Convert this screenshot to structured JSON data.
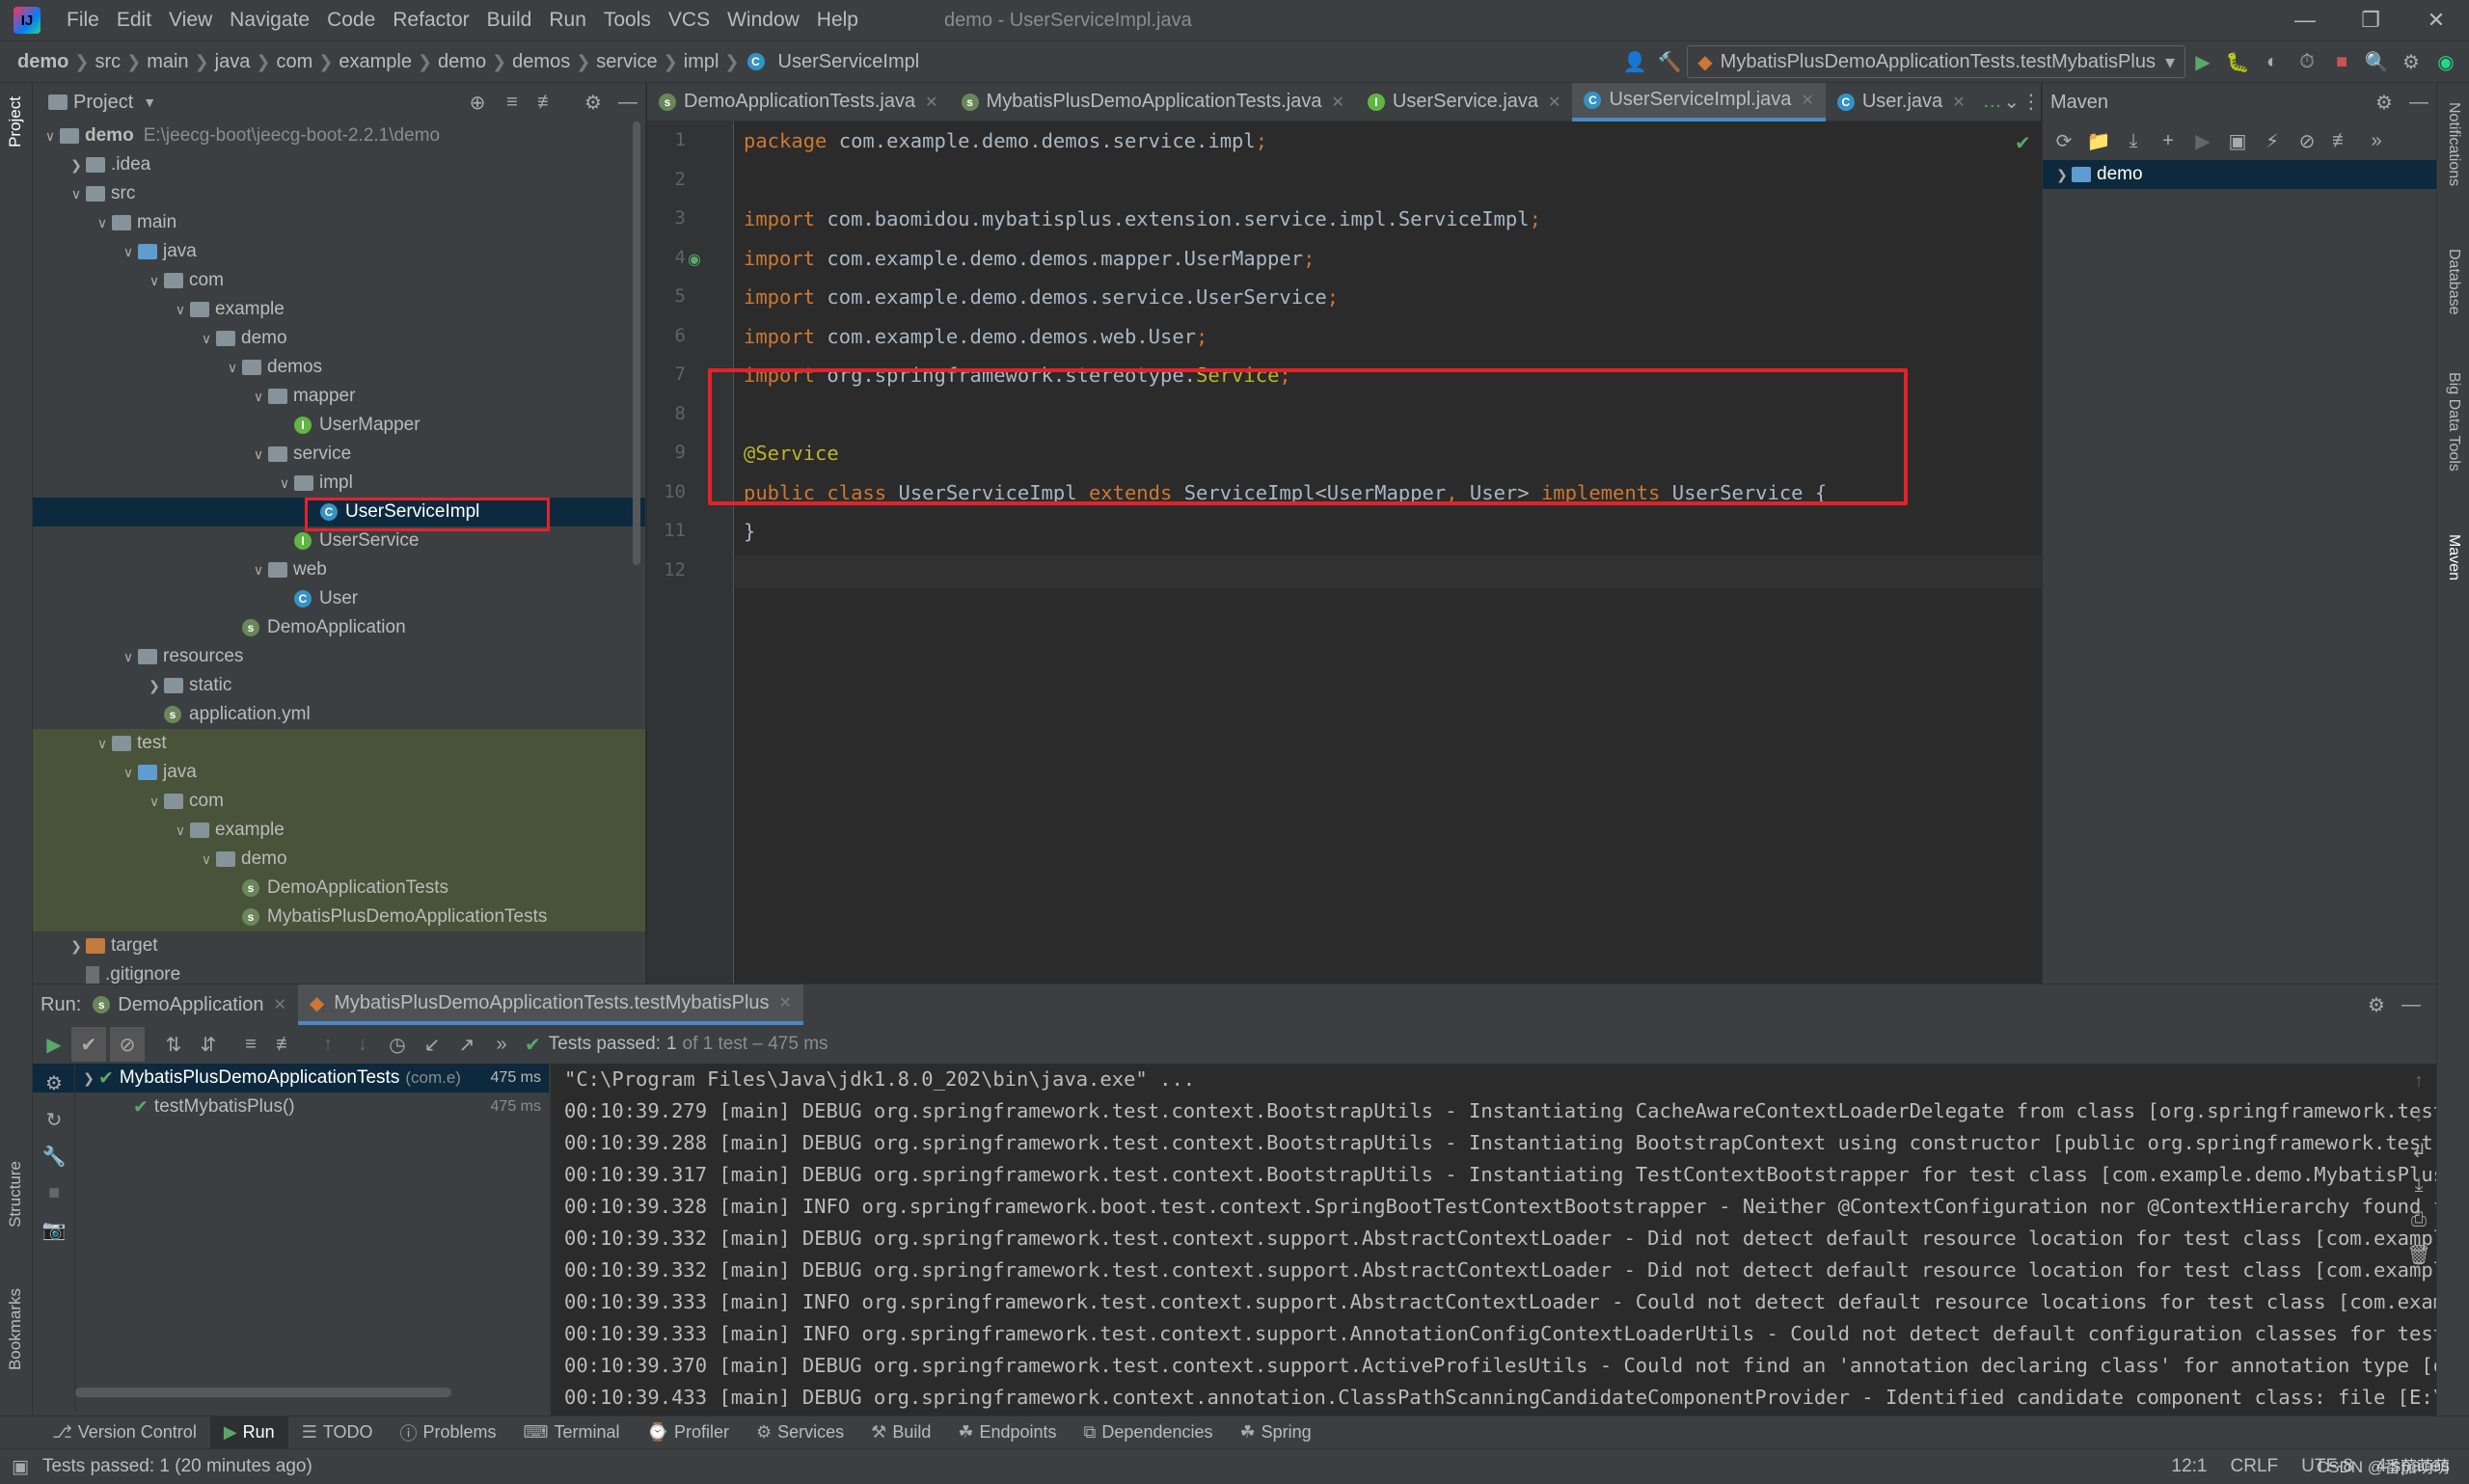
{
  "window": {
    "title": "demo - UserServiceImpl.java",
    "menu": [
      "File",
      "Edit",
      "View",
      "Navigate",
      "Code",
      "Refactor",
      "Build",
      "Run",
      "Tools",
      "VCS",
      "Window",
      "Help"
    ]
  },
  "breadcrumb": [
    "demo",
    "src",
    "main",
    "java",
    "com",
    "example",
    "demo",
    "demos",
    "service",
    "impl",
    "UserServiceImpl"
  ],
  "run_config": "MybatisPlusDemoApplicationTests.testMybatisPlus",
  "left_stripe": {
    "project": "Project",
    "structure": "Structure",
    "bookmarks": "Bookmarks"
  },
  "right_stripe": {
    "notifications": "Notifications",
    "database": "Database",
    "big_data": "Big Data Tools",
    "maven": "Maven"
  },
  "project_panel": {
    "title": "Project",
    "root_path": "E:\\jeecg-boot\\jeecg-boot-2.2.1\\demo",
    "tree": [
      {
        "label": "demo",
        "level": 0,
        "icon": "folder",
        "arrow": "down",
        "bold": true
      },
      {
        "label": ".idea",
        "level": 1,
        "icon": "folder",
        "arrow": "right"
      },
      {
        "label": "src",
        "level": 1,
        "icon": "folder",
        "arrow": "down"
      },
      {
        "label": "main",
        "level": 2,
        "icon": "folder",
        "arrow": "down"
      },
      {
        "label": "java",
        "level": 3,
        "icon": "folder-blue",
        "arrow": "down"
      },
      {
        "label": "com",
        "level": 4,
        "icon": "folder",
        "arrow": "down"
      },
      {
        "label": "example",
        "level": 5,
        "icon": "folder",
        "arrow": "down"
      },
      {
        "label": "demo",
        "level": 6,
        "icon": "folder",
        "arrow": "down"
      },
      {
        "label": "demos",
        "level": 7,
        "icon": "folder",
        "arrow": "down"
      },
      {
        "label": "mapper",
        "level": 8,
        "icon": "folder",
        "arrow": "down"
      },
      {
        "label": "UserMapper",
        "level": 9,
        "icon": "interface"
      },
      {
        "label": "service",
        "level": 8,
        "icon": "folder",
        "arrow": "down"
      },
      {
        "label": "impl",
        "level": 9,
        "icon": "folder",
        "arrow": "down"
      },
      {
        "label": "UserServiceImpl",
        "level": 10,
        "icon": "class",
        "selected": true
      },
      {
        "label": "UserService",
        "level": 9,
        "icon": "interface"
      },
      {
        "label": "web",
        "level": 8,
        "icon": "folder",
        "arrow": "down"
      },
      {
        "label": "User",
        "level": 9,
        "icon": "class"
      },
      {
        "label": "DemoApplication",
        "level": 7,
        "icon": "spring"
      },
      {
        "label": "resources",
        "level": 3,
        "icon": "folder",
        "arrow": "down"
      },
      {
        "label": "static",
        "level": 4,
        "icon": "folder",
        "arrow": "right"
      },
      {
        "label": "application.yml",
        "level": 4,
        "icon": "spring"
      },
      {
        "label": "test",
        "level": 2,
        "icon": "folder",
        "arrow": "down",
        "green": true
      },
      {
        "label": "java",
        "level": 3,
        "icon": "folder-green",
        "arrow": "down",
        "green": true
      },
      {
        "label": "com",
        "level": 4,
        "icon": "folder",
        "arrow": "down",
        "green": true
      },
      {
        "label": "example",
        "level": 5,
        "icon": "folder",
        "arrow": "down",
        "green": true
      },
      {
        "label": "demo",
        "level": 6,
        "icon": "folder",
        "arrow": "down",
        "green": true
      },
      {
        "label": "DemoApplicationTests",
        "level": 7,
        "icon": "spring",
        "green": true
      },
      {
        "label": "MybatisPlusDemoApplicationTests",
        "level": 7,
        "icon": "spring",
        "green": true
      },
      {
        "label": "target",
        "level": 1,
        "icon": "folder-orange",
        "arrow": "right"
      },
      {
        "label": ".gitignore",
        "level": 1,
        "icon": "file"
      }
    ]
  },
  "editor_tabs": [
    {
      "label": "DemoApplicationTests.java",
      "icon": "spring"
    },
    {
      "label": "MybatisPlusDemoApplicationTests.java",
      "icon": "spring"
    },
    {
      "label": "UserService.java",
      "icon": "interface"
    },
    {
      "label": "UserServiceImpl.java",
      "icon": "class",
      "active": true
    },
    {
      "label": "User.java",
      "icon": "class"
    }
  ],
  "code": [
    {
      "n": "1",
      "parts": [
        [
          "kw",
          "package "
        ],
        [
          "",
          "com.example.demo.demos.service.impl"
        ],
        [
          "kw",
          ";"
        ]
      ]
    },
    {
      "n": "2",
      "parts": []
    },
    {
      "n": "3",
      "parts": [
        [
          "kw",
          "import "
        ],
        [
          "",
          "com.baomidou.mybatisplus.extension.service.impl.ServiceImpl"
        ],
        [
          "kw",
          ";"
        ]
      ]
    },
    {
      "n": "4",
      "parts": [
        [
          "kw",
          "import "
        ],
        [
          "",
          "com.example.demo.demos.mapper.UserMapper"
        ],
        [
          "kw",
          ";"
        ]
      ]
    },
    {
      "n": "5",
      "parts": [
        [
          "kw",
          "import "
        ],
        [
          "",
          "com.example.demo.demos.service.UserService"
        ],
        [
          "kw",
          ";"
        ]
      ]
    },
    {
      "n": "6",
      "parts": [
        [
          "kw",
          "import "
        ],
        [
          "",
          "com.example.demo.demos.web.User"
        ],
        [
          "kw",
          ";"
        ]
      ]
    },
    {
      "n": "7",
      "parts": [
        [
          "kw",
          "import "
        ],
        [
          "",
          "org.springframework.stereotype."
        ],
        [
          "ann",
          "Service"
        ],
        [
          "kw",
          ";"
        ]
      ]
    },
    {
      "n": "8",
      "parts": []
    },
    {
      "n": "9",
      "parts": [
        [
          "ann",
          "@Service"
        ]
      ]
    },
    {
      "n": "10",
      "parts": [
        [
          "kw",
          "public class "
        ],
        [
          "",
          "UserServiceImpl "
        ],
        [
          "kw",
          "extends "
        ],
        [
          "",
          "ServiceImpl<UserMapper"
        ],
        [
          "kw",
          ", "
        ],
        [
          "",
          "User> "
        ],
        [
          "kw",
          "implements "
        ],
        [
          "",
          "UserService {"
        ]
      ]
    },
    {
      "n": "11",
      "parts": [
        [
          "",
          "}"
        ]
      ]
    },
    {
      "n": "12",
      "parts": []
    }
  ],
  "maven": {
    "title": "Maven",
    "root": "demo"
  },
  "run_panel": {
    "label": "Run:",
    "tabs": [
      "DemoApplication",
      "MybatisPlusDemoApplicationTests.testMybatisPlus"
    ],
    "status_prefix": "Tests passed:",
    "status_count": "1",
    "status_suffix": "of 1 test – 475 ms",
    "test_tree": [
      {
        "label": "MybatisPlusDemoApplicationTests",
        "hint": "(com.e)",
        "time": "475 ms"
      },
      {
        "label": "testMybatisPlus()",
        "time": "475 ms"
      }
    ],
    "console": [
      "\"C:\\Program Files\\Java\\jdk1.8.0_202\\bin\\java.exe\" ...",
      "00:10:39.279 [main] DEBUG org.springframework.test.context.BootstrapUtils - Instantiating CacheAwareContextLoaderDelegate from class [org.springframework.test",
      "00:10:39.288 [main] DEBUG org.springframework.test.context.BootstrapUtils - Instantiating BootstrapContext using constructor [public org.springframework.test.",
      "00:10:39.317 [main] DEBUG org.springframework.test.context.BootstrapUtils - Instantiating TestContextBootstrapper for test class [com.example.demo.MybatisPlus",
      "00:10:39.328 [main] INFO org.springframework.boot.test.context.SpringBootTestContextBootstrapper - Neither @ContextConfiguration nor @ContextHierarchy found f",
      "00:10:39.332 [main] DEBUG org.springframework.test.context.support.AbstractContextLoader - Did not detect default resource location for test class [com.exampl",
      "00:10:39.332 [main] DEBUG org.springframework.test.context.support.AbstractContextLoader - Did not detect default resource location for test class [com.exampl",
      "00:10:39.333 [main] INFO org.springframework.test.context.support.AbstractContextLoader - Could not detect default resource locations for test class [com.exam",
      "00:10:39.333 [main] INFO org.springframework.test.context.support.AnnotationConfigContextLoaderUtils - Could not detect default configuration classes for test",
      "00:10:39.370 [main] DEBUG org.springframework.test.context.support.ActiveProfilesUtils - Could not find an 'annotation declaring class' for annotation type [o",
      "00:10:39.433 [main] DEBUG org.springframework.context.annotation.ClassPathScanningCandidateComponentProvider - Identified candidate component class: file [E:\\"
    ]
  },
  "bottom_tools": [
    "Version Control",
    "Run",
    "TODO",
    "Problems",
    "Terminal",
    "Profiler",
    "Services",
    "Build",
    "Endpoints",
    "Dependencies",
    "Spring"
  ],
  "status_bar": {
    "message": "Tests passed: 1 (20 minutes ago)",
    "position": "12:1",
    "line_sep": "CRLF",
    "encoding": "UTF-8",
    "indent": "4 spaces",
    "watermark": "CSDN @番茄萌萌"
  },
  "colors": {
    "accent": "#4a88c7",
    "highlight_box": "#e3222a",
    "keyword": "#cc7832",
    "annotation": "#bbb529"
  }
}
